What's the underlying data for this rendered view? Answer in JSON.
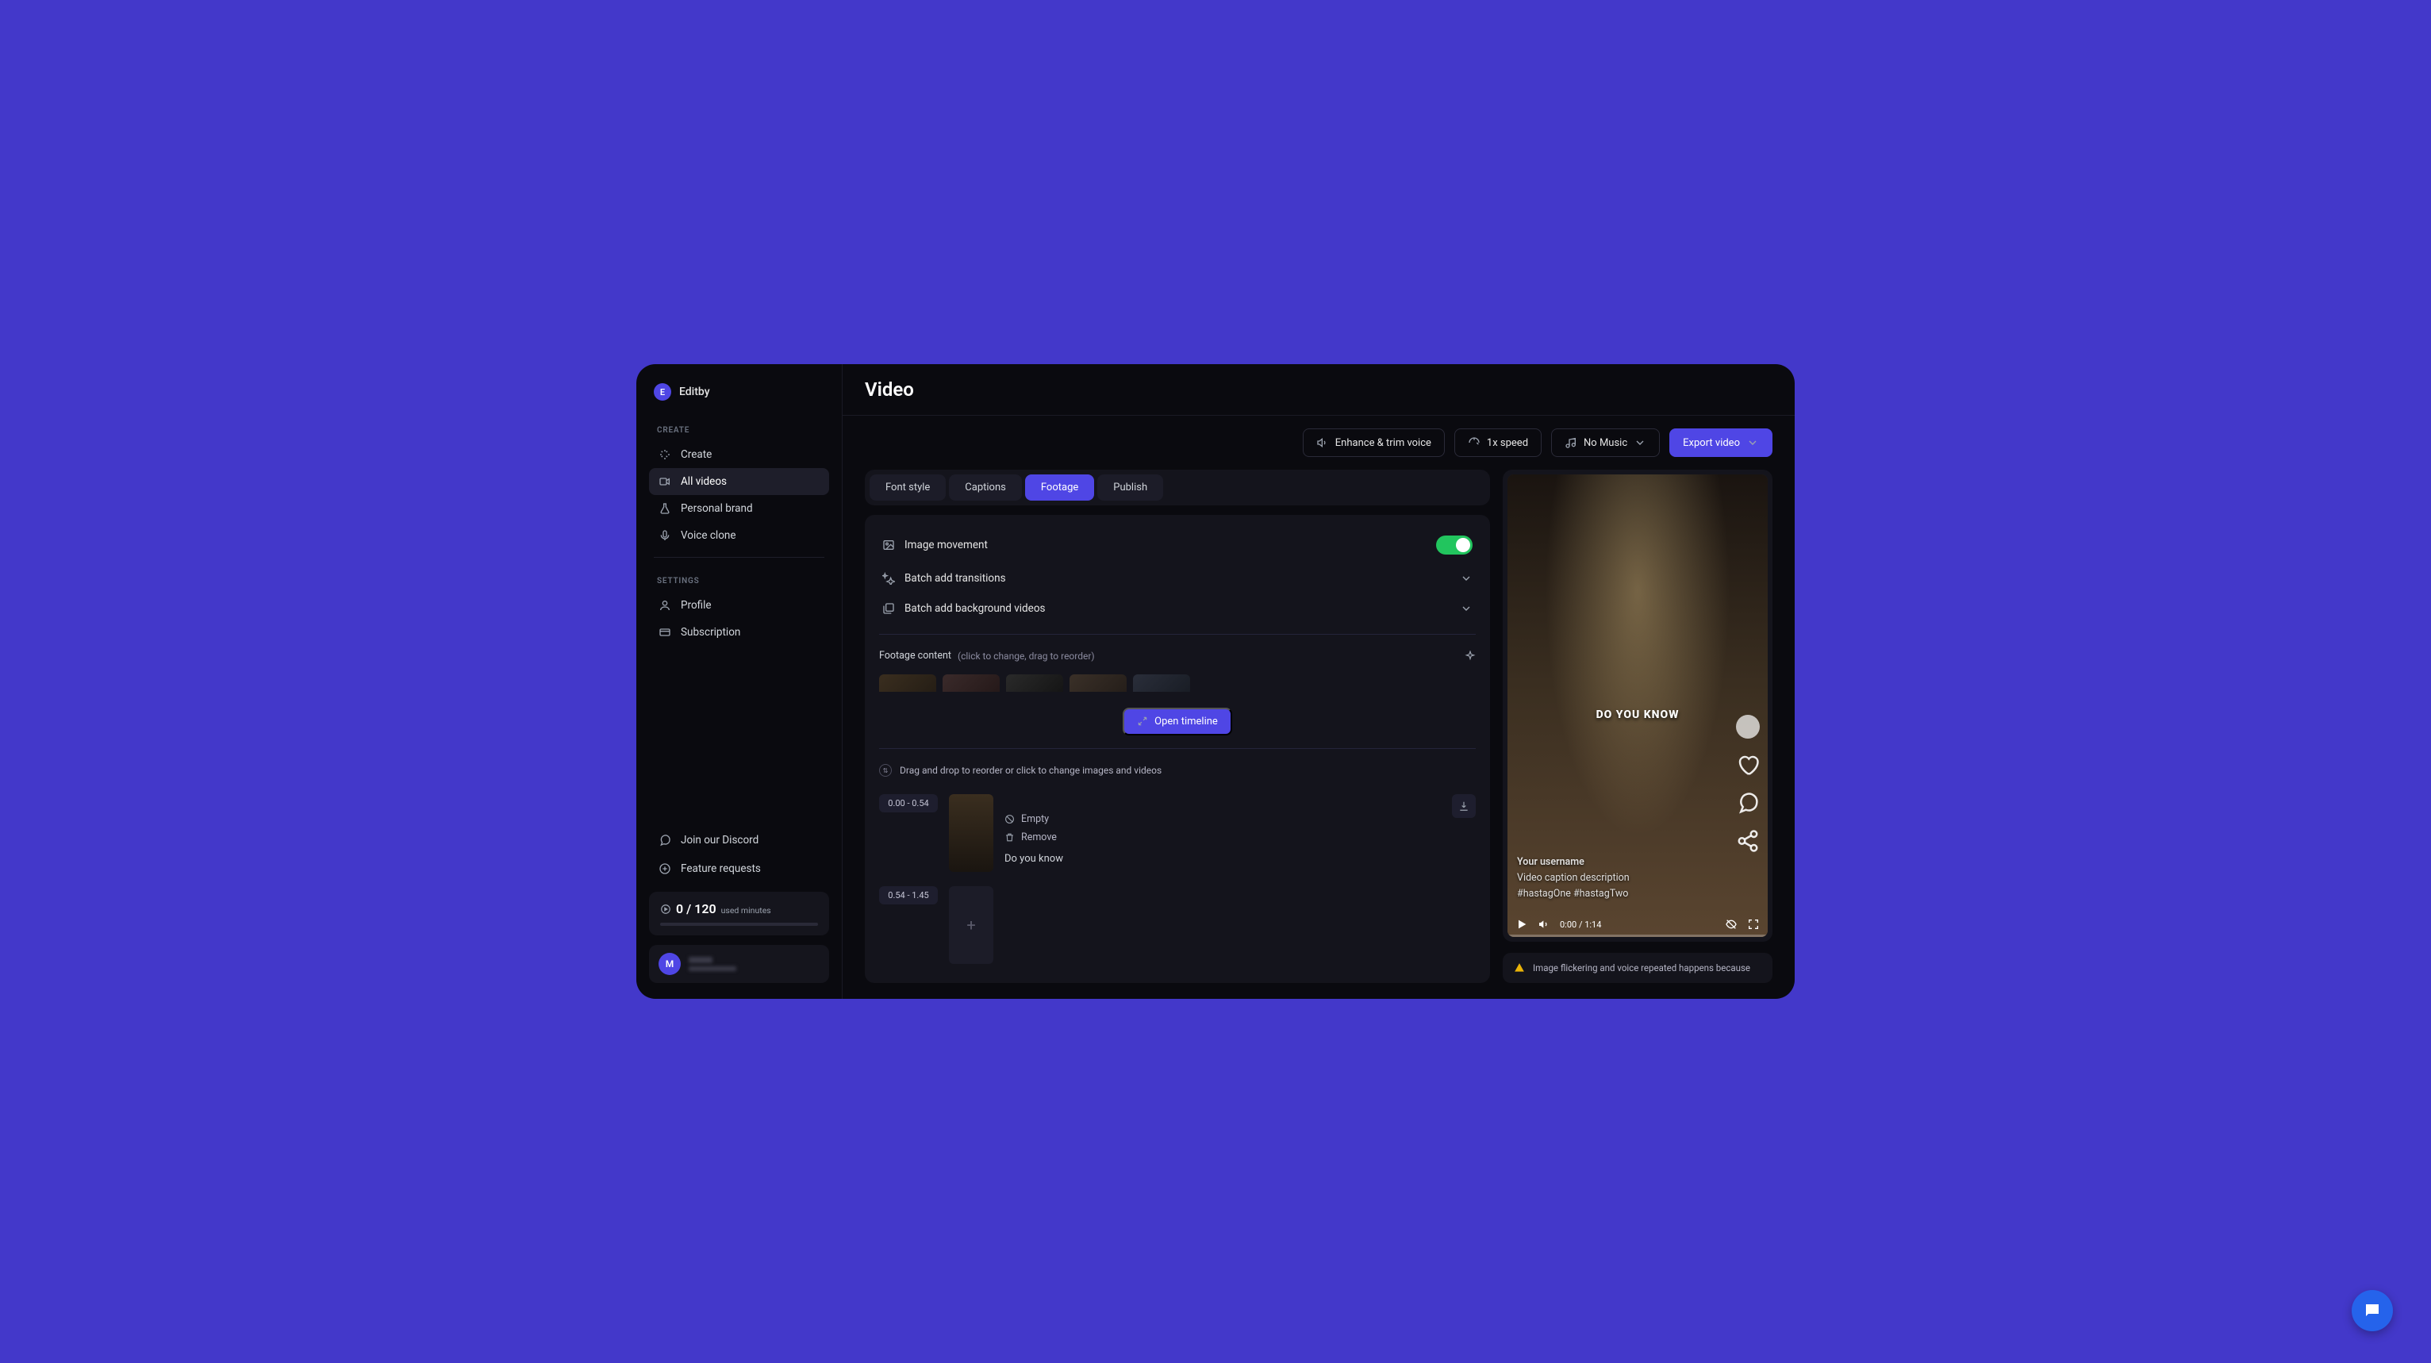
{
  "brand": {
    "initial": "E",
    "name": "Editby"
  },
  "sidebar": {
    "create_label": "CREATE",
    "settings_label": "SETTINGS",
    "items": [
      {
        "label": "Create"
      },
      {
        "label": "All videos"
      },
      {
        "label": "Personal brand"
      },
      {
        "label": "Voice clone"
      },
      {
        "label": "Profile"
      },
      {
        "label": "Subscription"
      }
    ],
    "discord": "Join our Discord",
    "features": "Feature requests"
  },
  "usage": {
    "value": "0 / 120",
    "label": "used minutes"
  },
  "user": {
    "initial": "M"
  },
  "header": {
    "title": "Video"
  },
  "toolbar": {
    "enhance": "Enhance & trim voice",
    "speed": "1x speed",
    "music": "No Music",
    "export": "Export video"
  },
  "tabs": [
    {
      "label": "Font style"
    },
    {
      "label": "Captions"
    },
    {
      "label": "Footage"
    },
    {
      "label": "Publish"
    }
  ],
  "options": {
    "image_movement": "Image movement",
    "batch_transitions": "Batch add transitions",
    "batch_bg": "Batch add background videos"
  },
  "footage": {
    "label": "Footage content",
    "hint": "(click to change, drag to reorder)",
    "open_timeline": "Open timeline",
    "drag_hint": "Drag and drop to reorder or click to change images and videos"
  },
  "clips": [
    {
      "time": "0.00 - 0.54",
      "empty": "Empty",
      "remove": "Remove",
      "text": "Do you know"
    },
    {
      "time": "0.54 - 1.45"
    }
  ],
  "preview": {
    "caption": "DO YOU KNOW",
    "username": "Your username",
    "description": "Video caption description",
    "hashtags": "#hastagOne #hastagTwo",
    "time": "0:00 / 1:14"
  },
  "warning": {
    "text": "Image flickering and voice repeated happens because"
  }
}
